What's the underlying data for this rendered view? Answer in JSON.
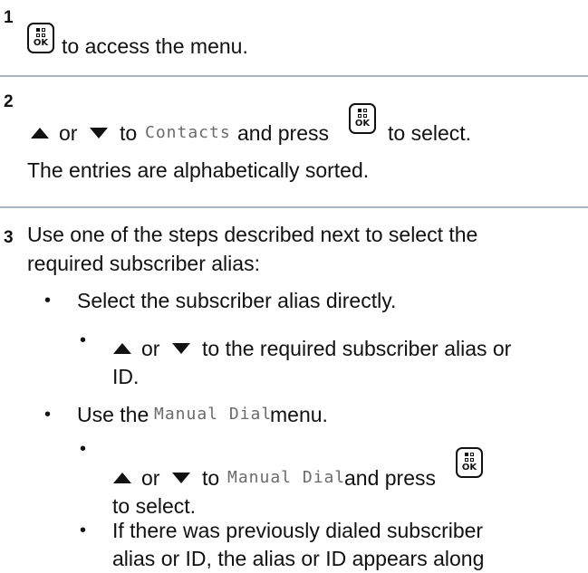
{
  "steps": [
    {
      "number": "1",
      "text_after_key": "to access the menu."
    },
    {
      "number": "2",
      "or": "or",
      "to": "to",
      "lcd_contacts": "Contacts",
      "and_press": "and press",
      "to_select": "to select.",
      "note": "The entries are alphabetically sorted."
    },
    {
      "number": "3",
      "intro_line1": "Use one of the steps described next to select the",
      "intro_line2": "required subscriber alias:",
      "options": [
        {
          "text": "Select the subscriber alias directly.",
          "sub": {
            "or": "or",
            "line1": "to the required subscriber alias or",
            "line2": "ID."
          }
        },
        {
          "text_before": "Use the",
          "lcd": "Manual Dial",
          "text_after": "menu.",
          "sub": {
            "or": "or",
            "to": "to",
            "lcd": "Manual Dial",
            "and_press": "and press",
            "line2": "to select."
          }
        },
        {
          "line1": "If there was previously dialed subscriber",
          "line2": "alias or ID, the alias or ID appears along"
        }
      ]
    }
  ],
  "icons": {
    "ok_key": "ok-menu-key-icon",
    "up": "arrow-up-icon",
    "down": "arrow-down-icon"
  },
  "ok_label": "OK"
}
